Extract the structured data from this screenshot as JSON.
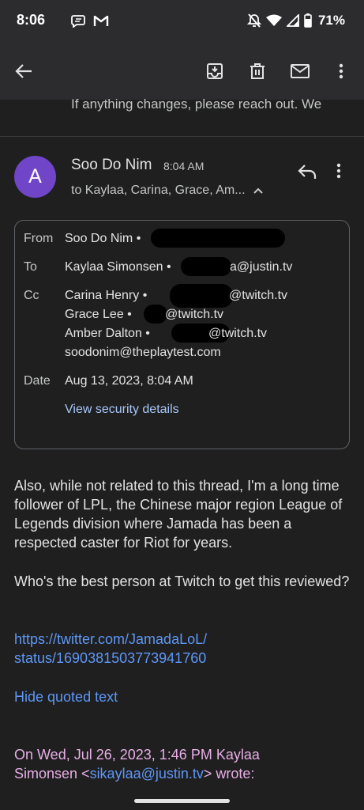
{
  "status_bar": {
    "time": "8:06",
    "battery": "71%",
    "left_icons": [
      "chat-bubble-icon",
      "gmail-icon"
    ],
    "right_icons": [
      "mute-icon",
      "wifi-icon",
      "signal-icon",
      "battery-icon"
    ]
  },
  "toolbar": {
    "back_icon": "back-arrow-icon",
    "actions": [
      "archive-icon",
      "delete-icon",
      "mail-icon",
      "more-vert-icon"
    ]
  },
  "previous_message_snippet": "If anything changes, please reach out. We",
  "message": {
    "avatar_letter": "A",
    "sender": "Soo Do Nim",
    "time": "8:04 AM",
    "recipients_summary": "to Kaylaa, Carina, Grace, Am...",
    "details": {
      "from_label": "From",
      "from": "Soo Do Nim •",
      "to_label": "To",
      "to": "Kaylaa Simonsen •",
      "to_email_tail": "a@justin.tv",
      "cc_label": "Cc",
      "cc": [
        {
          "name": "Carina Henry •",
          "email_tail": "@twitch.tv"
        },
        {
          "name": "Grace Lee •",
          "email_tail": "@twitch.tv"
        },
        {
          "name": "Amber Dalton •",
          "email_tail": "@twitch.tv"
        }
      ],
      "cc_extra": "soodonim@theplaytest.com",
      "date_label": "Date",
      "date": "Aug 13, 2023, 8:04 AM",
      "security_link": "View security details"
    },
    "body": {
      "paragraph1": "Also, while not related to this thread, I'm a long time follower of LPL, the Chinese major region League of Legends division where Jamada has been a respected caster for Riot for years.",
      "paragraph2": "Who's the best person at Twitch to get this reviewed?",
      "link_line1": "https://twitter.com/JamadaLoL/",
      "link_line2": "status/1690381503773941760",
      "hide_quoted": "Hide quoted text",
      "quote_header_1": "On Wed, Jul 26, 2023, 1:46 PM Kaylaa",
      "quote_header_2a": "Simonsen <",
      "quote_email": "sikaylaa@justin.tv",
      "quote_header_2b": "> wrote:"
    }
  },
  "colors": {
    "background": "#1f1f1f",
    "toolbar": "#2c2c2f",
    "avatar": "#7145c7",
    "link": "#5e97f6",
    "quote": "#e8aee6"
  }
}
